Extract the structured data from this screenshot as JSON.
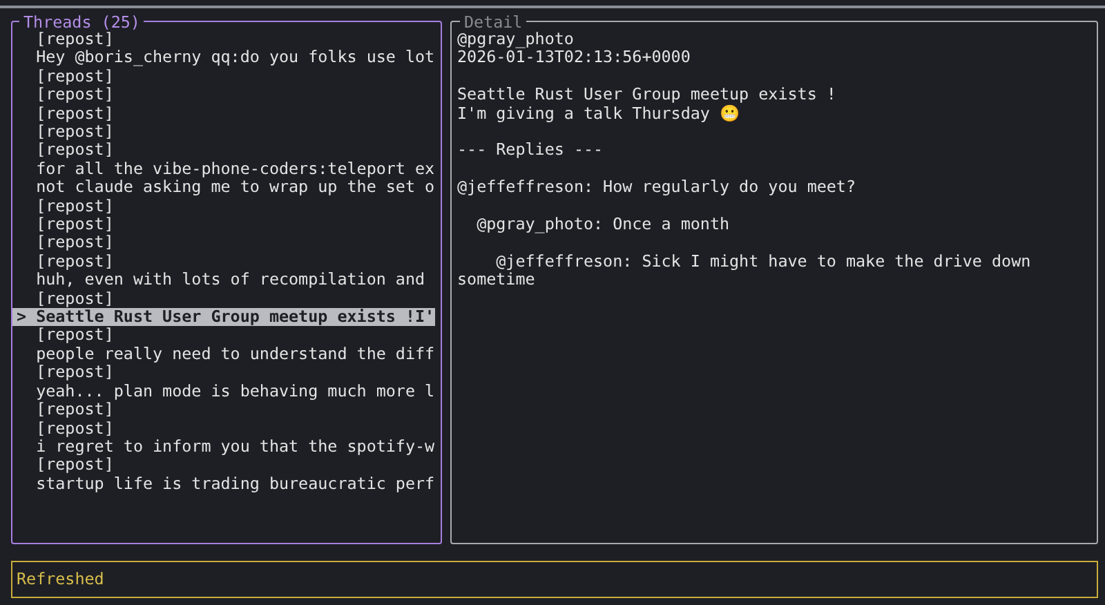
{
  "threads": {
    "title": "Threads (25)",
    "cursor": ">",
    "items": [
      {
        "text": "[repost]",
        "selected": false
      },
      {
        "text": "Hey @boris_cherny qq:do you folks use lot",
        "selected": false
      },
      {
        "text": "[repost]",
        "selected": false
      },
      {
        "text": "[repost]",
        "selected": false
      },
      {
        "text": "[repost]",
        "selected": false
      },
      {
        "text": "[repost]",
        "selected": false
      },
      {
        "text": "[repost]",
        "selected": false
      },
      {
        "text": "for all the vibe-phone-coders:teleport ex",
        "selected": false
      },
      {
        "text": "not claude asking me to wrap up the set o",
        "selected": false
      },
      {
        "text": "[repost]",
        "selected": false
      },
      {
        "text": "[repost]",
        "selected": false
      },
      {
        "text": "[repost]",
        "selected": false
      },
      {
        "text": "[repost]",
        "selected": false
      },
      {
        "text": "huh, even with lots of recompilation and",
        "selected": false
      },
      {
        "text": "[repost]",
        "selected": false
      },
      {
        "text": "Seattle Rust User Group meetup exists !I'",
        "selected": true
      },
      {
        "text": "[repost]",
        "selected": false
      },
      {
        "text": "people really need to understand the diff",
        "selected": false
      },
      {
        "text": "[repost]",
        "selected": false
      },
      {
        "text": "yeah... plan mode is behaving much more l",
        "selected": false
      },
      {
        "text": "[repost]",
        "selected": false
      },
      {
        "text": "[repost]",
        "selected": false
      },
      {
        "text": "i regret to inform you that the spotify-w",
        "selected": false
      },
      {
        "text": "[repost]",
        "selected": false
      },
      {
        "text": "startup life is trading bureaucratic perf",
        "selected": false
      }
    ]
  },
  "detail": {
    "title": "Detail",
    "author": "@pgray_photo",
    "timestamp": "2026-01-13T02:13:56+0000",
    "body": [
      "Seattle Rust User Group meetup exists !",
      "I'm giving a talk Thursday 😬"
    ],
    "replies_heading": "--- Replies ---",
    "replies": [
      {
        "text": "@jeffeffreson: How regularly do you meet?",
        "children": [
          {
            "text": "@pgray_photo: Once a month",
            "children": [
              {
                "text": "@jeffeffreson: Sick I might have to make the drive down sometime"
              }
            ]
          }
        ]
      }
    ]
  },
  "status": {
    "message": "Refreshed"
  }
}
